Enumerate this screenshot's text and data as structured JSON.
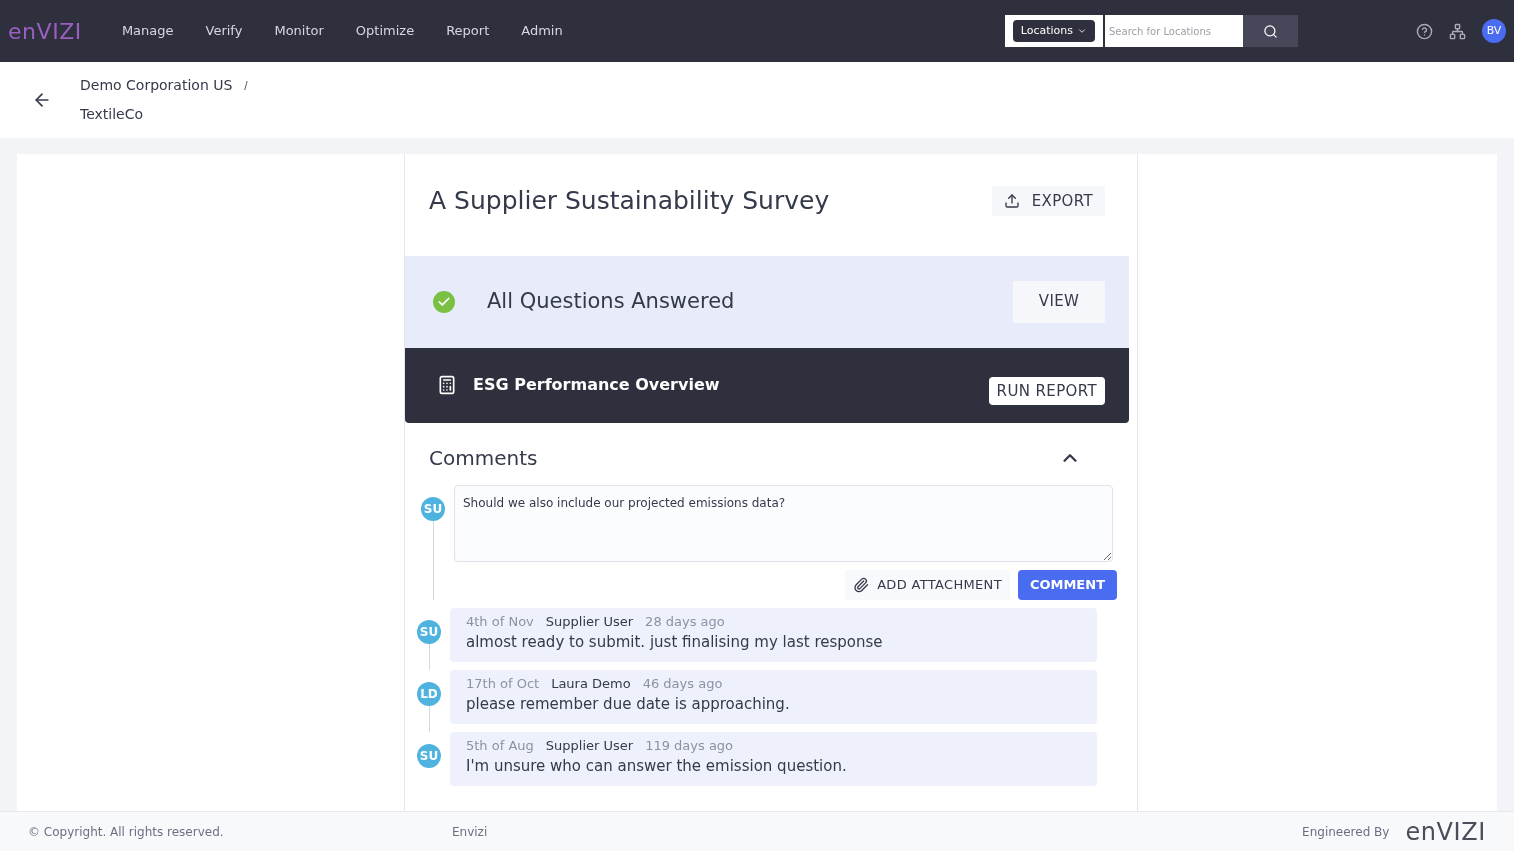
{
  "header": {
    "logo": "enVIZI",
    "nav": [
      {
        "label": "Manage",
        "selected": false
      },
      {
        "label": "Verify",
        "selected": false
      },
      {
        "label": "Monitor",
        "selected": false
      },
      {
        "label": "Optimize",
        "selected": false
      },
      {
        "label": "Report",
        "selected": false
      },
      {
        "label": "Admin",
        "selected": false
      }
    ],
    "search": {
      "scope": "Locations",
      "placeholder": "Search for Locations"
    },
    "avatar": "BV"
  },
  "breadcrumb": {
    "parent": "Demo Corporation US",
    "separator": "/",
    "current": "TextileCo"
  },
  "survey": {
    "title": "A Supplier Sustainability Survey",
    "export": "EXPORT",
    "status": {
      "text": "All Questions Answered",
      "complete": true,
      "button": "VIEW"
    },
    "report": {
      "text": "ESG Performance Overview",
      "button": "RUN REPORT"
    }
  },
  "comments": {
    "title": "Comments",
    "expanded": true,
    "composer": {
      "avatar": "SU",
      "value": "Should we also include our projected emissions data?",
      "attach": "ADD ATTACHMENT",
      "submit": "COMMENT"
    },
    "items": [
      {
        "avatar": "SU",
        "date": "4th of Nov",
        "author": "Supplier User",
        "ago": "28 days ago",
        "text": "almost ready to submit. just finalising my last response"
      },
      {
        "avatar": "LD",
        "date": "17th of Oct",
        "author": "Laura Demo",
        "ago": "46 days ago",
        "text": "please remember due date is approaching."
      },
      {
        "avatar": "SU",
        "date": "5th of Aug",
        "author": "Supplier User",
        "ago": "119 days ago",
        "text": "I'm unsure who can answer the emission question."
      }
    ]
  },
  "footer": {
    "copyright": "© Copyright. All rights reserved.",
    "center": "Envizi",
    "engineered": "Engineered By",
    "logo": "enVIZI"
  }
}
